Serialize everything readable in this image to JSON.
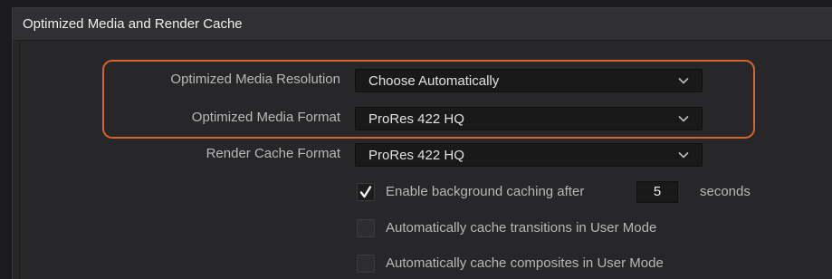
{
  "panel": {
    "title": "Optimized Media and Render Cache"
  },
  "settings": [
    {
      "label": "Optimized Media Resolution",
      "value": "Choose Automatically"
    },
    {
      "label": "Optimized Media Format",
      "value": "ProRes 422 HQ"
    },
    {
      "label": "Render Cache Format",
      "value": "ProRes 422 HQ"
    }
  ],
  "caching": {
    "background": {
      "checked": true,
      "label": "Enable background caching after",
      "seconds": "5",
      "unit": "seconds"
    },
    "transitions": {
      "checked": false,
      "label": "Automatically cache transitions in User Mode"
    },
    "composites": {
      "checked": false,
      "label": "Automatically cache composites in User Mode"
    }
  },
  "colors": {
    "highlight": "#d4662b",
    "panel_bg": "#272729",
    "field_bg": "#19191a"
  },
  "icons": {
    "dropdown": "chevron-down-icon",
    "check": "checkmark-icon"
  }
}
